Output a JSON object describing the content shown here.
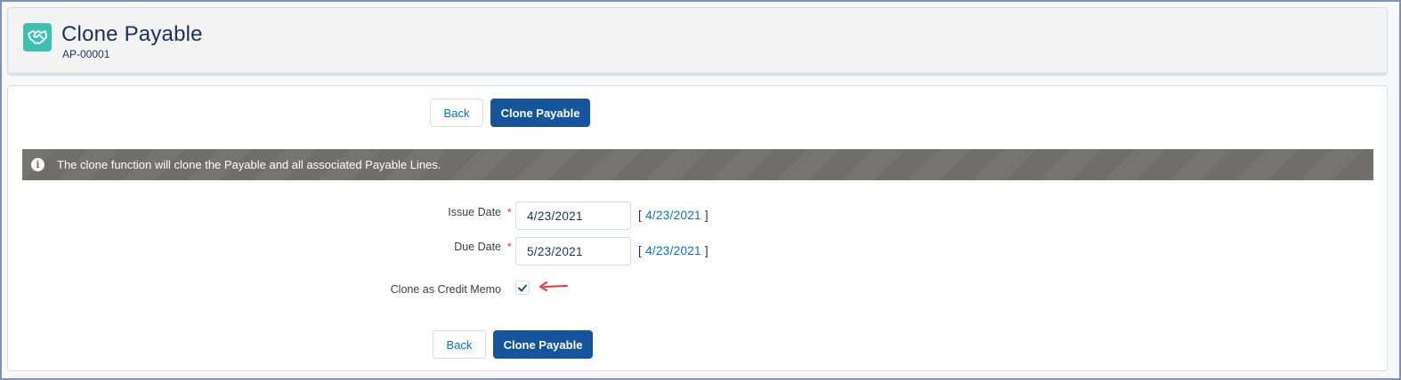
{
  "header": {
    "title": "Clone Payable",
    "record_id": "AP-00001",
    "icon": "handshake-icon"
  },
  "actions_top": {
    "back_label": "Back",
    "clone_label": "Clone Payable"
  },
  "info": {
    "icon": "info-icon",
    "message": "The clone function will clone the Payable and all associated Payable Lines."
  },
  "form": {
    "issue_date": {
      "label": "Issue Date",
      "required_mark": "*",
      "value": "4/23/2021",
      "original": "4/23/2021"
    },
    "due_date": {
      "label": "Due Date",
      "required_mark": "*",
      "value": "5/23/2021",
      "original": "4/23/2021"
    },
    "credit_memo": {
      "label": "Clone as Credit Memo",
      "checked": true
    }
  },
  "actions_bottom": {
    "back_label": "Back",
    "clone_label": "Clone Payable"
  },
  "colors": {
    "brand": "#16549b",
    "icon_bg": "#3ebfb1",
    "info_bar": "#706e6b",
    "link": "#0070d2",
    "required": "#c23934",
    "annotation_arrow": "#e03a3a"
  }
}
